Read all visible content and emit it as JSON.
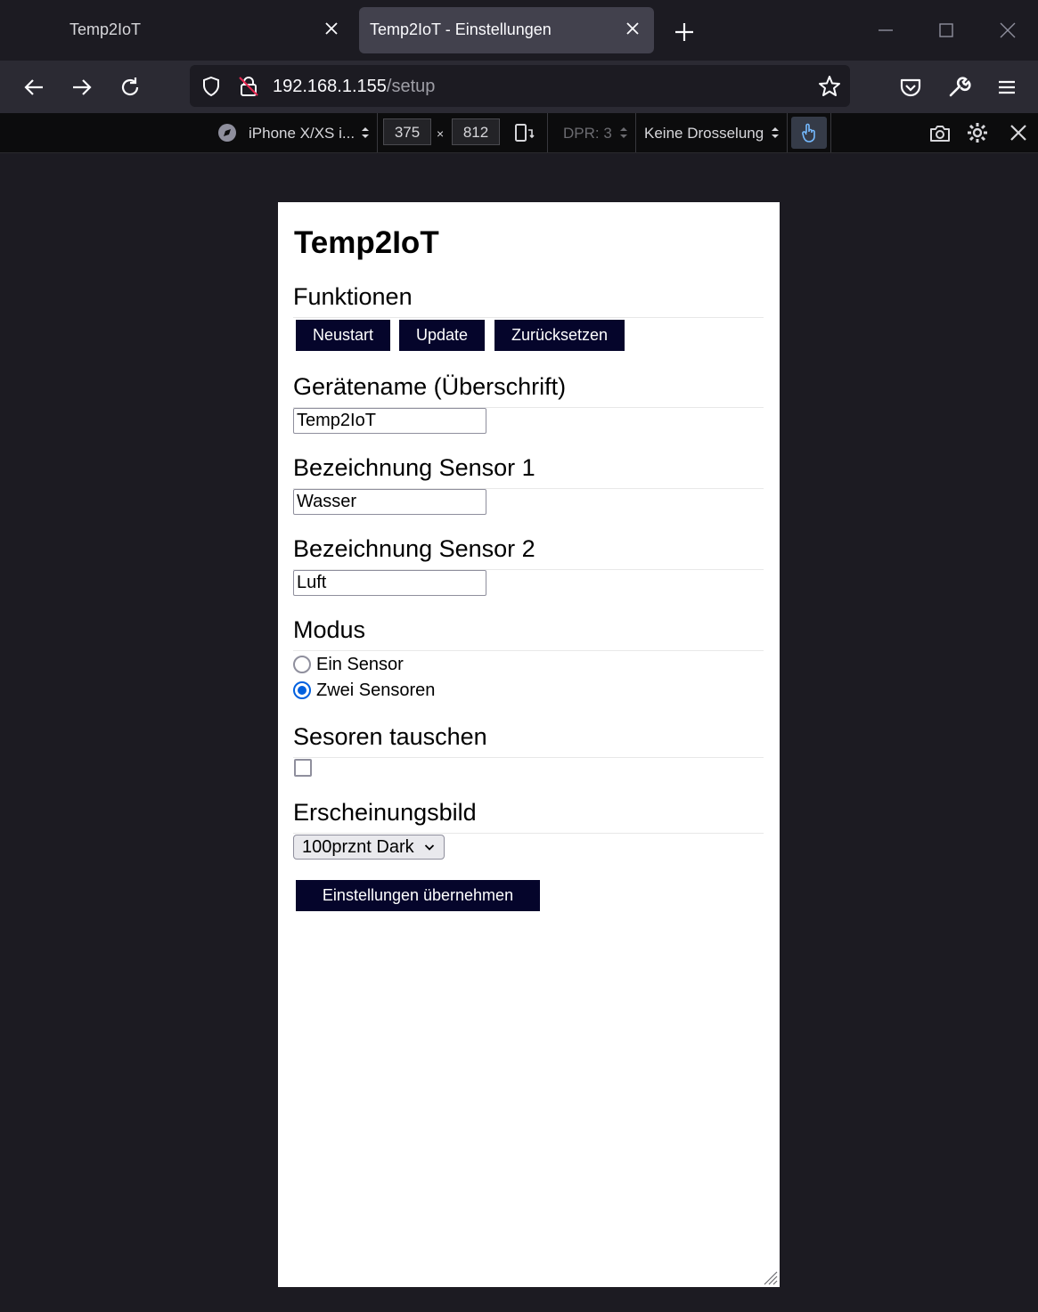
{
  "browser": {
    "tabs": [
      {
        "title": "Temp2IoT",
        "active": false
      },
      {
        "title": "Temp2IoT - Einstellungen",
        "active": true
      }
    ],
    "url_host": "192.168.1.155",
    "url_path": "/setup"
  },
  "rdm": {
    "device": "iPhone X/XS i...",
    "width": "375",
    "times": "×",
    "height": "812",
    "dpr": "DPR: 3",
    "throttling": "Keine Drosselung"
  },
  "page": {
    "title": "Temp2IoT",
    "functions": {
      "heading": "Funktionen",
      "restart": "Neustart",
      "update": "Update",
      "reset": "Zurücksetzen"
    },
    "device_name": {
      "heading": "Gerätename (Überschrift)",
      "value": "Temp2IoT"
    },
    "sensor1": {
      "heading": "Bezeichnung Sensor 1",
      "value": "Wasser"
    },
    "sensor2": {
      "heading": "Bezeichnung Sensor 2",
      "value": "Luft"
    },
    "mode": {
      "heading": "Modus",
      "options": [
        {
          "label": "Ein Sensor",
          "checked": false
        },
        {
          "label": "Zwei Sensoren",
          "checked": true
        }
      ]
    },
    "swap": {
      "heading": "Sesoren tauschen",
      "checked": false
    },
    "appearance": {
      "heading": "Erscheinungsbild",
      "selected": "100prznt Dark"
    },
    "submit": "Einstellungen übernehmen"
  },
  "colors": {
    "button_bg": "#05052b",
    "radio_accent": "#0060df",
    "chrome_bg": "#1c1b22"
  }
}
